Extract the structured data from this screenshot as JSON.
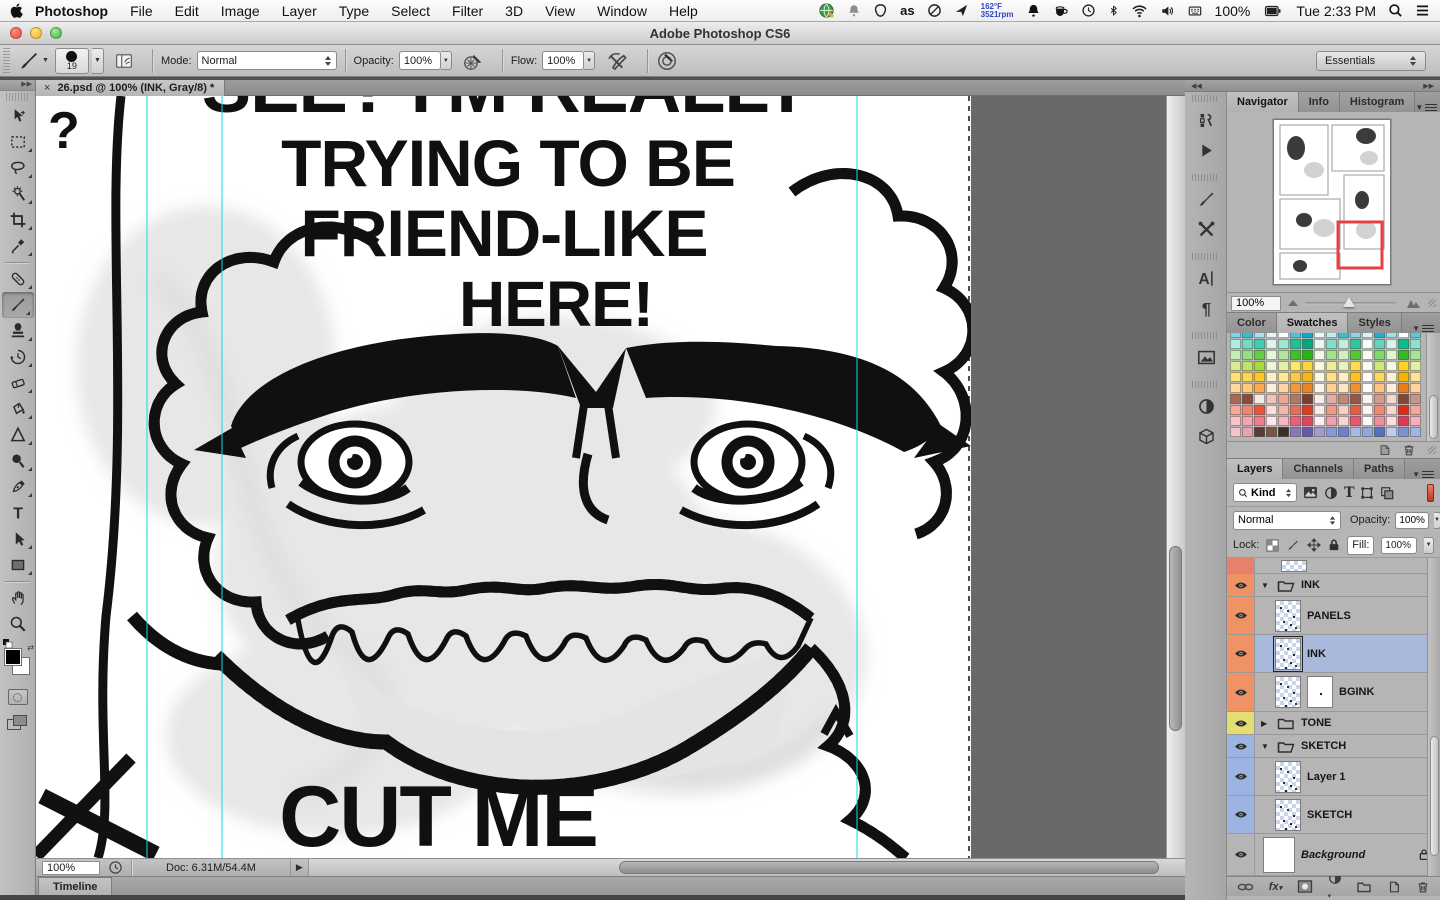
{
  "menubar": {
    "app_menu": "Photoshop",
    "menus": [
      "File",
      "Edit",
      "Image",
      "Layer",
      "Type",
      "Select",
      "Filter",
      "3D",
      "View",
      "Window",
      "Help"
    ],
    "temp_line1": "162°F",
    "temp_line2": "3521rpm",
    "battery_percent": "100%",
    "clock": "Tue 2:33 PM"
  },
  "titlebar": {
    "title": "Adobe Photoshop CS6"
  },
  "options_bar": {
    "brush_size": "19",
    "mode_label": "Mode:",
    "mode_value": "Normal",
    "opacity_label": "Opacity:",
    "opacity_value": "100%",
    "flow_label": "Flow:",
    "flow_value": "100%",
    "workspace": "Essentials"
  },
  "toolbar": {
    "tools": [
      "move",
      "marquee",
      "lasso",
      "quick-selection",
      "crop",
      "eyedropper",
      "healing-brush",
      "brush",
      "clone-stamp",
      "history-brush",
      "eraser",
      "paint-bucket",
      "blur",
      "dodge",
      "pen",
      "type",
      "path-selection",
      "shape",
      "hand",
      "zoom"
    ],
    "selected": "brush"
  },
  "document_tab": {
    "close": "×",
    "title": "26.psd @ 100% (INK, Gray/8) *"
  },
  "canvas": {
    "top_line_clipped": "SEE? I'M REALLY",
    "line1": "TRYING TO BE",
    "line2": "FRIEND-LIKE",
    "line3": "HERE!",
    "bottom_line": "CUT ME",
    "question_mark": "?",
    "guide_color": "#00e2ea"
  },
  "dock_groups": [
    [
      "layer-comps",
      "actions"
    ],
    [
      "brush-panel",
      "tool-presets"
    ],
    [
      "character",
      "paragraph"
    ],
    [
      "mini-bridge"
    ],
    [
      "adjustments",
      "three-d"
    ]
  ],
  "navigator": {
    "tabs": [
      "Navigator",
      "Info",
      "Histogram"
    ],
    "active_tab": "Navigator",
    "zoom_value": "100%",
    "viewbox_color": "#e84040"
  },
  "swatches_panel": {
    "tabs": [
      "Color",
      "Swatches",
      "Styles"
    ],
    "active_tab": "Swatches",
    "colors": [
      "#7dd7e8",
      "#27c3e0",
      "#a9e2ef",
      "#e6f6f9",
      "#ffffff",
      "#45c8d9",
      "#00b0cd",
      "#f0fafb",
      "#c3ebf2",
      "#2fbfd8",
      "#8ad8e6",
      "#dff3f7",
      "#10b6d1",
      "#a2dfeb",
      "#ffffff",
      "#56cce0",
      "#b3ecdf",
      "#73dac5",
      "#3ecfae",
      "#dcf6ee",
      "#9fe6d4",
      "#1fc296",
      "#00a87d",
      "#e8f9f2",
      "#85ddc7",
      "#c2eee0",
      "#2fc79e",
      "#f6fcfa",
      "#63d5bb",
      "#d8f4ea",
      "#0abd8c",
      "#8fe0cc",
      "#c5edb6",
      "#96de7f",
      "#62cd49",
      "#e5f7db",
      "#b1e69c",
      "#3fc02c",
      "#28b418",
      "#eef9e7",
      "#a2e28b",
      "#d1f1c1",
      "#52c838",
      "#f8fcf5",
      "#82d867",
      "#def5d0",
      "#35bb22",
      "#a9e494",
      "#d7ed94",
      "#c0e468",
      "#a8dc3e",
      "#f0f7d8",
      "#e0f1aa",
      "#ffe76a",
      "#ffd53a",
      "#fcf7de",
      "#f2ec96",
      "#e6f3bf",
      "#ffdc4c",
      "#fcfcf2",
      "#cde87e",
      "#f5f9e4",
      "#ffd322",
      "#e3efa6",
      "#ffe270",
      "#ffd84a",
      "#ffc81e",
      "#fdf0c8",
      "#ffe898",
      "#ffca43",
      "#f7b817",
      "#fdf6e0",
      "#ffe088",
      "#fff0c0",
      "#ffc226",
      "#fffdf6",
      "#ffd95e",
      "#fdf3d2",
      "#f4b400",
      "#ffe394",
      "#ffd9a0",
      "#ffc97a",
      "#f9a94e",
      "#fdeede",
      "#ffd4a8",
      "#f09a3e",
      "#e88624",
      "#fdf4ea",
      "#ffcf96",
      "#ffe4c6",
      "#ef9030",
      "#fefaf4",
      "#ffc184",
      "#fdeedd",
      "#e87d1a",
      "#ffd2a0",
      "#a86858",
      "#8a4a3c",
      "#f8e8e4",
      "#f0c4b8",
      "#e8a898",
      "#b07868",
      "#7a3c2e",
      "#fbeeea",
      "#e0b0a4",
      "#c08878",
      "#94564a",
      "#fcf4f2",
      "#d49c8c",
      "#f4d8d0",
      "#84463a",
      "#c89488",
      "#f4a898",
      "#ee8570",
      "#e8543a",
      "#fbe0da",
      "#f0b8ac",
      "#e6705a",
      "#de3c20",
      "#fcebe7",
      "#ec9b88",
      "#f6cfc6",
      "#e25f44",
      "#fdf3f1",
      "#ee8a74",
      "#f8d8d1",
      "#da2e12",
      "#f0ab9c",
      "#f8c6c6",
      "#f4a4ac",
      "#ee7e8e",
      "#fce8ea",
      "#f6b8c0",
      "#ea6078",
      "#e24462",
      "#fdf0f2",
      "#f2a0b0",
      "#f9d4da",
      "#e85570",
      "#fef6f8",
      "#f08ea0",
      "#fadee2",
      "#de3a58",
      "#f4b0bc",
      "#f2c4cc",
      "#eaa2b4",
      "#5a3c34",
      "#7a5648",
      "#3e2c26",
      "#8878b8",
      "#6858a8",
      "#a49cd0",
      "#8a98d8",
      "#6e80c8",
      "#aab8e6",
      "#92a6dc",
      "#5870bc",
      "#c0cdf0",
      "#7e92d0",
      "#a0b4e8"
    ]
  },
  "layers_panel": {
    "tabs": [
      "Layers",
      "Channels",
      "Paths"
    ],
    "active_tab": "Layers",
    "filter_label": "Kind",
    "blend_mode": "Normal",
    "opacity_label": "Opacity:",
    "opacity_value": "100%",
    "lock_label": "Lock:",
    "fill_label": "Fill:",
    "fill_value": "100%",
    "rows": [
      {
        "kind": "partial",
        "name": "",
        "color": "#e8806c"
      },
      {
        "kind": "group",
        "name": "INK",
        "color": "#ef9266",
        "expanded": true
      },
      {
        "kind": "layer",
        "name": "PANELS",
        "color": "#ef9266",
        "selected": false
      },
      {
        "kind": "layer",
        "name": "INK",
        "color": "#ef9266",
        "selected": true
      },
      {
        "kind": "layer-mask",
        "name": "BGINK",
        "color": "#ef9266",
        "selected": false
      },
      {
        "kind": "group",
        "name": "TONE",
        "color": "#e3dd74",
        "expanded": false
      },
      {
        "kind": "group",
        "name": "SKETCH",
        "color": "#9db4e2",
        "expanded": true
      },
      {
        "kind": "layer",
        "name": "Layer 1",
        "color": "#9db4e2",
        "selected": false
      },
      {
        "kind": "layer",
        "name": "SKETCH",
        "color": "#9db4e2",
        "selected": false
      },
      {
        "kind": "background",
        "name": "Background",
        "color": "#b5b5b5"
      }
    ]
  },
  "status_bar": {
    "zoom": "100%",
    "doc_info": "Doc: 6.31M/54.4M"
  },
  "timeline": {
    "label": "Timeline"
  }
}
